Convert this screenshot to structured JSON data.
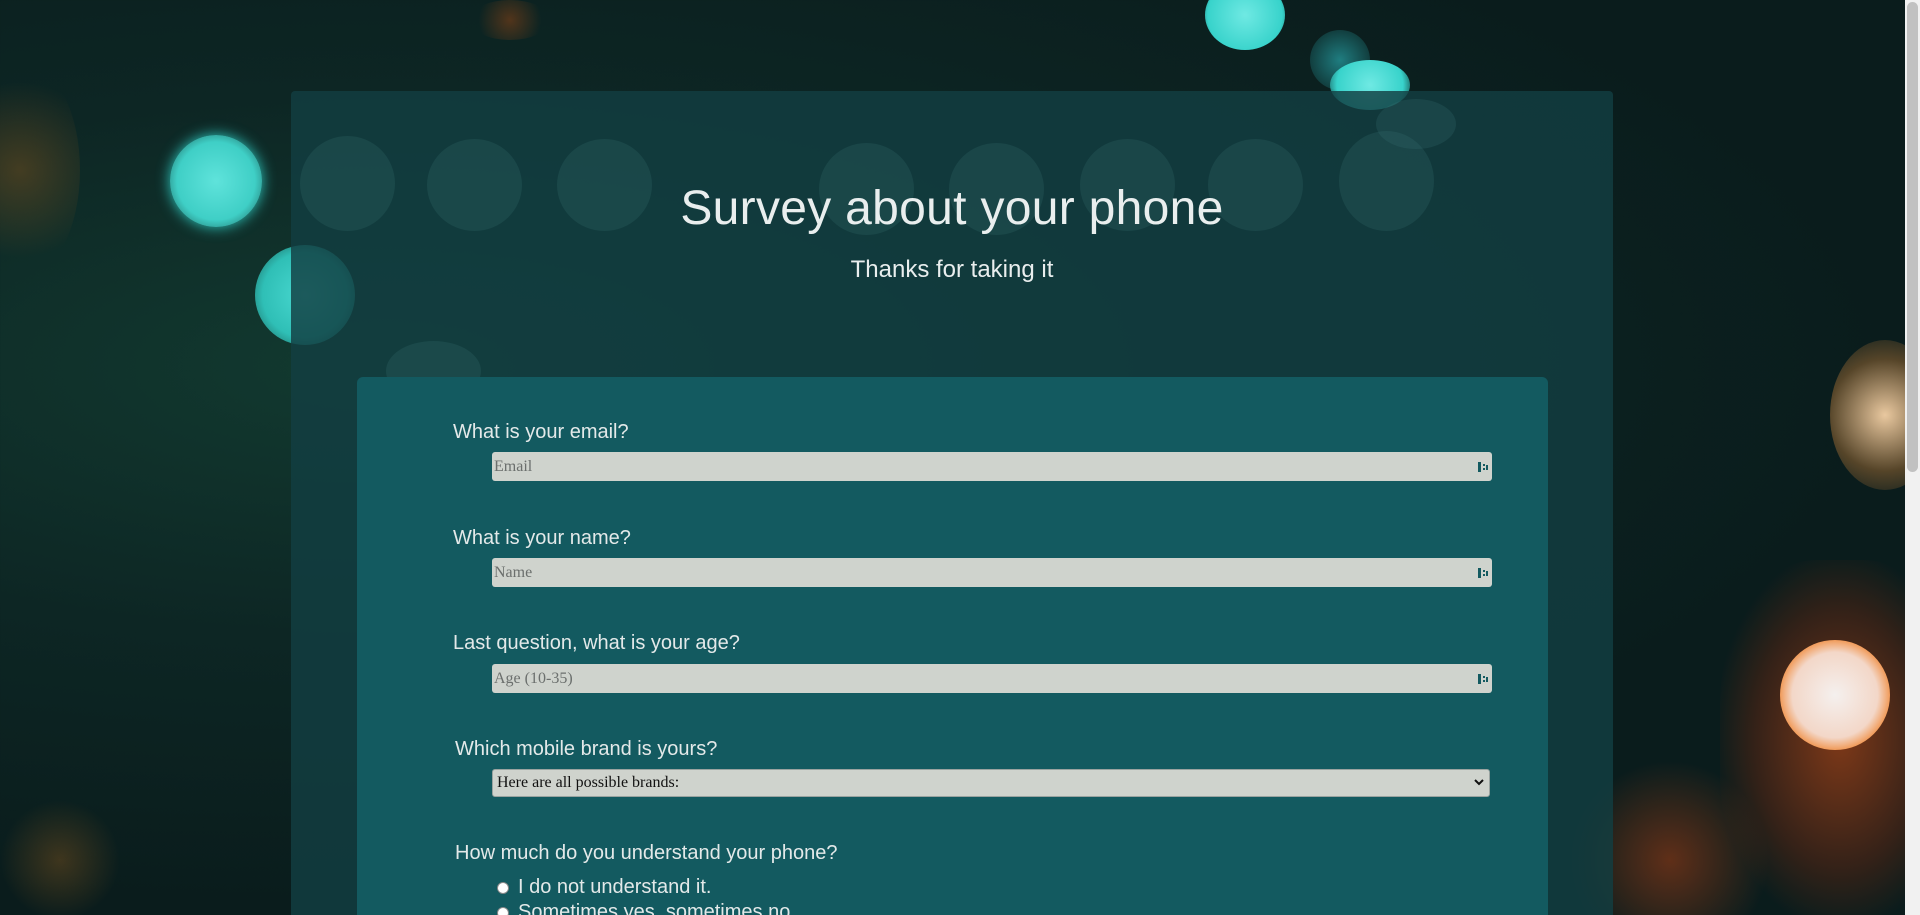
{
  "header": {
    "title": "Survey about your phone",
    "subtitle": "Thanks for taking it"
  },
  "questions": {
    "email": {
      "label": "What is your email?",
      "placeholder": "Email",
      "value": ""
    },
    "name": {
      "label": "What is your name?",
      "placeholder": "Name",
      "value": ""
    },
    "age": {
      "label": "Last question, what is your age?",
      "placeholder": "Age (10-35)",
      "value": ""
    },
    "brand": {
      "label": "Which mobile brand is yours?",
      "selected": "Here are all possible brands:"
    },
    "understanding": {
      "label": "How much do you understand your phone?",
      "options": [
        "I do not understand it.",
        "Sometimes yes, sometimes no"
      ]
    }
  },
  "icons": {
    "autofill": "autofill-key-icon",
    "dropdown": "chevron-down-icon",
    "radio": "radio-button-icon"
  },
  "colors": {
    "card_bg": "#123e42",
    "form_bg": "#135a60",
    "input_bg": "#cfd3cd",
    "text": "#e3e9e9"
  }
}
